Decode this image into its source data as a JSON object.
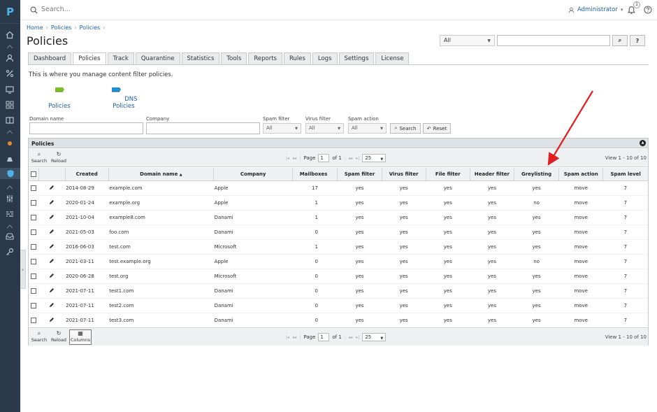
{
  "app": {
    "logo_letter": "P"
  },
  "topbar": {
    "search_placeholder": "Search...",
    "user_name": "Administrator",
    "user_caret": "▾",
    "notifications_count": "1"
  },
  "breadcrumb": [
    "Home",
    "Policies",
    "Policies"
  ],
  "page_title": "Policies",
  "global_search": {
    "select_value": "All",
    "search_glyph": "⌕",
    "help_label": "?"
  },
  "tabs": [
    "Dashboard",
    "Policies",
    "Track",
    "Quarantine",
    "Statistics",
    "Tools",
    "Reports",
    "Rules",
    "Logs",
    "Settings",
    "License"
  ],
  "active_tab": "Policies",
  "intro_text": "This is where you manage content filter policies.",
  "shortcuts": [
    {
      "label": "Policies",
      "color": "#7cc11f"
    },
    {
      "label": "DNS Policies",
      "color": "#1f8fd6"
    }
  ],
  "filters": {
    "domain_label": "Domain name",
    "company_label": "Company",
    "spam_label": "Spam filter",
    "spam_value": "All",
    "virus_label": "Virus filter",
    "virus_value": "All",
    "action_label": "Spam action",
    "action_value": "All",
    "search_btn": "Search",
    "reset_btn": "Reset"
  },
  "grid": {
    "caption": "Policies",
    "toolbar": {
      "search": "Search",
      "reload": "Reload",
      "columns": "Columns"
    },
    "pager": {
      "page_label": "Page",
      "page_value": "1",
      "of_label": "of 1",
      "per_page": "25"
    },
    "view_info": "View 1 - 10 of 10",
    "columns": [
      "",
      "",
      "Created",
      "Domain name",
      "Company",
      "Mailboxes",
      "Spam filter",
      "Virus filter",
      "File filter",
      "Header filter",
      "Greylisting",
      "Spam action",
      "Spam level"
    ],
    "rows": [
      [
        "2014-08-29",
        "example.com",
        "Apple",
        "17",
        "yes",
        "yes",
        "yes",
        "yes",
        "yes",
        "move",
        "7"
      ],
      [
        "2020-01-24",
        "example.org",
        "Apple",
        "1",
        "yes",
        "yes",
        "yes",
        "yes",
        "no",
        "move",
        "7"
      ],
      [
        "2021-10-04",
        "example8.com",
        "Danami",
        "1",
        "yes",
        "yes",
        "yes",
        "yes",
        "yes",
        "move",
        "7"
      ],
      [
        "2021-05-03",
        "foo.com",
        "Danami",
        "0",
        "yes",
        "yes",
        "yes",
        "yes",
        "yes",
        "move",
        "7"
      ],
      [
        "2016-06-03",
        "test.com",
        "Microsoft",
        "1",
        "yes",
        "yes",
        "yes",
        "yes",
        "yes",
        "move",
        "7"
      ],
      [
        "2021-03-11",
        "test.example.org",
        "Apple",
        "0",
        "yes",
        "yes",
        "yes",
        "yes",
        "no",
        "move",
        "7"
      ],
      [
        "2020-06-28",
        "test.org",
        "Microsoft",
        "0",
        "yes",
        "yes",
        "yes",
        "yes",
        "yes",
        "move",
        "7"
      ],
      [
        "2021-07-11",
        "test1.com",
        "Danami",
        "0",
        "yes",
        "yes",
        "yes",
        "yes",
        "yes",
        "move",
        "7"
      ],
      [
        "2021-07-11",
        "test2.com",
        "Danami",
        "0",
        "yes",
        "yes",
        "yes",
        "yes",
        "yes",
        "move",
        "7"
      ],
      [
        "2021-07-11",
        "test3.com",
        "Danami",
        "0",
        "yes",
        "yes",
        "yes",
        "yes",
        "yes",
        "move",
        "7"
      ]
    ]
  },
  "colors": {
    "yes": "#3a8a3a",
    "no": "#d22222",
    "annotation_arrow": "#e02020",
    "link": "#1f5ea8"
  }
}
